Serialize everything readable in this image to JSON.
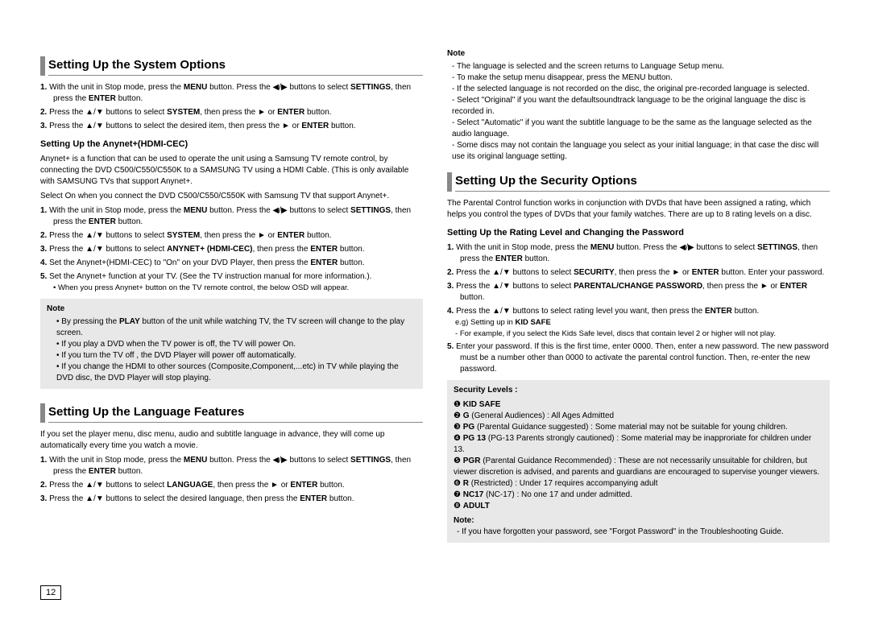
{
  "pageNumber": "12",
  "icons": {
    "left": "◀",
    "right": "▶",
    "up": "▲",
    "down": "▼",
    "play": "►"
  },
  "left": {
    "s1": {
      "title": "Setting Up the System Options",
      "steps": [
        "With the unit in Stop mode, press the <b>MENU</b> button. Press the ◀/▶ buttons to select <b>SETTINGS</b>, then press the <b>ENTER</b> button.",
        "Press the ▲/▼ buttons to select <b>SYSTEM</b>, then press the ► or <b>ENTER</b> button.",
        "Press the ▲/▼ buttons to select the desired item, then press the ► or <b>ENTER</b> button."
      ],
      "sub": {
        "title": "Setting Up the Anynet+(HDMI-CEC)",
        "text": "Anynet+ is a function that can be used to operate the unit using a Samsung TV remote control, by connecting the DVD C500/C550/C550K to a SAMSUNG TV using a HDMI Cable. (This is only available with SAMSUNG TVs that support Anynet+.",
        "text2": "Select On when you connect the DVD C500/C550/C550K with Samsung TV that support Anynet+.",
        "steps": [
          "With the unit in Stop mode, press the <b>MENU</b> button. Press the ◀/▶ buttons to select <b>SETTINGS</b>, then press the <b>ENTER</b> button.",
          "Press the ▲/▼ buttons to select <b>SYSTEM</b>, then press the ► or <b>ENTER</b> button.",
          "Press the ▲/▼ buttons to select <b>ANYNET+ (HDMI-CEC)</b>, then press the <b>ENTER</b> button.",
          "Set the Anynet+(HDMI-CEC) to \"On\" on your DVD Player, then press the <b>ENTER</b> button.",
          "Set the Anynet+ function at your TV. (See the TV instruction manual for more information.)."
        ],
        "stepExtra": "• When you press Anynet+ button on the TV remote control, the below OSD will appear."
      },
      "note": {
        "label": "Note",
        "items": [
          "By pressing the <b>PLAY</b> button of the unit while watching TV, the TV screen will change to the play screen.",
          "If you play a DVD when the TV power is off, the TV will power On.",
          "If you turn the TV off , the DVD Player will power off automatically.",
          "If you change the HDMI to other sources (Composite,Component,...etc) in TV while playing the DVD disc, the DVD Player will stop playing."
        ]
      }
    },
    "s2": {
      "title": "Setting Up the Language Features",
      "intro": "If you set the player menu, disc menu, audio and subtitle language in advance, they will come up automatically every time you watch a movie.",
      "steps": [
        "With the unit in Stop mode, press the <b>MENU</b> button. Press the ◀/▶ buttons to select <b>SETTINGS</b>, then press the <b>ENTER</b> button.",
        "Press the ▲/▼ buttons to select <b>LANGUAGE</b>, then press the ► or <b>ENTER</b> button.",
        "Press the ▲/▼ buttons to select the desired language, then press the <b>ENTER</b> button."
      ]
    }
  },
  "right": {
    "note": {
      "label": "Note",
      "items": [
        "The language is selected and the screen returns to Language Setup menu.",
        "To make the setup menu disappear, press the MENU button.",
        "If the selected language is not recorded on the disc, the original pre-recorded language is selected.",
        "Select \"Original\" if you want the defaultsoundtrack language to be the original language the disc is recorded in.",
        "Select \"Automatic\" if you want the subtitle language to be the same as the language selected as the audio language.",
        "Some discs may not contain the language you select as your initial language; in that case the disc will use its original language setting."
      ]
    },
    "s3": {
      "title": "Setting Up the Security Options",
      "intro": "The Parental Control function works in conjunction with DVDs that have been assigned a rating, which helps you control the types of DVDs that your family watches. There are up to 8 rating levels on a disc.",
      "sub": {
        "title": "Setting Up the Rating Level and Changing the Password",
        "steps": [
          "With the unit in Stop mode, press the <b>MENU</b> button. Press the ◀/▶ buttons to select <b>SETTINGS</b>, then press the <b>ENTER</b> button.",
          "Press the ▲/▼ buttons to select <b>SECURITY</b>, then press the ► or <b>ENTER</b> button. Enter your password.",
          "Press the ▲/▼ buttons to select <b>PARENTAL/CHANGE PASSWORD</b>, then press the ► or <b>ENTER</b> button.",
          "Press the ▲/▼ buttons to select rating level you want, then press the <b>ENTER</b> button.",
          "Enter your password. If this is the first time, enter 0000. Then, enter a new password. The new password must be a number other than 0000 to activate the parental control function. Then, re-enter the new password."
        ],
        "step4extra": "e.g) Setting up in <b>KID SAFE</b>",
        "step4extra2": "For example, if you select the Kids Safe level, discs that contain level 2 or higher will not play."
      },
      "sec": {
        "title": "Security Levels :",
        "items": [
          "❶ <b>KID SAFE</b>",
          "❷ <b>G</b> (General Audiences) : All Ages Admitted",
          "❸ <b>PG</b> (Parental Guidance suggested) : Some material may not be suitable for young children.",
          "❹ <b>PG 13</b> (PG-13 Parents strongly cautioned) : Some material may be inapproriate for children under 13.",
          "❺ <b>PGR</b> (Parental Guidance Recommended) : These are not necessarily unsuitable for children, but viewer discretion is advised, and parents and guardians are encouraged to supervise younger viewers.",
          "❻ <b>R</b> (Restricted) : Under 17 requires accompanying adult",
          "❼ <b>NC17</b> (NC-17) : No one 17 and under admitted.",
          "❽ <b>ADULT</b>"
        ],
        "noteLabel": "Note:",
        "noteText": "If you have forgotten your password, see \"Forgot Password\" in the Troubleshooting Guide."
      }
    }
  }
}
